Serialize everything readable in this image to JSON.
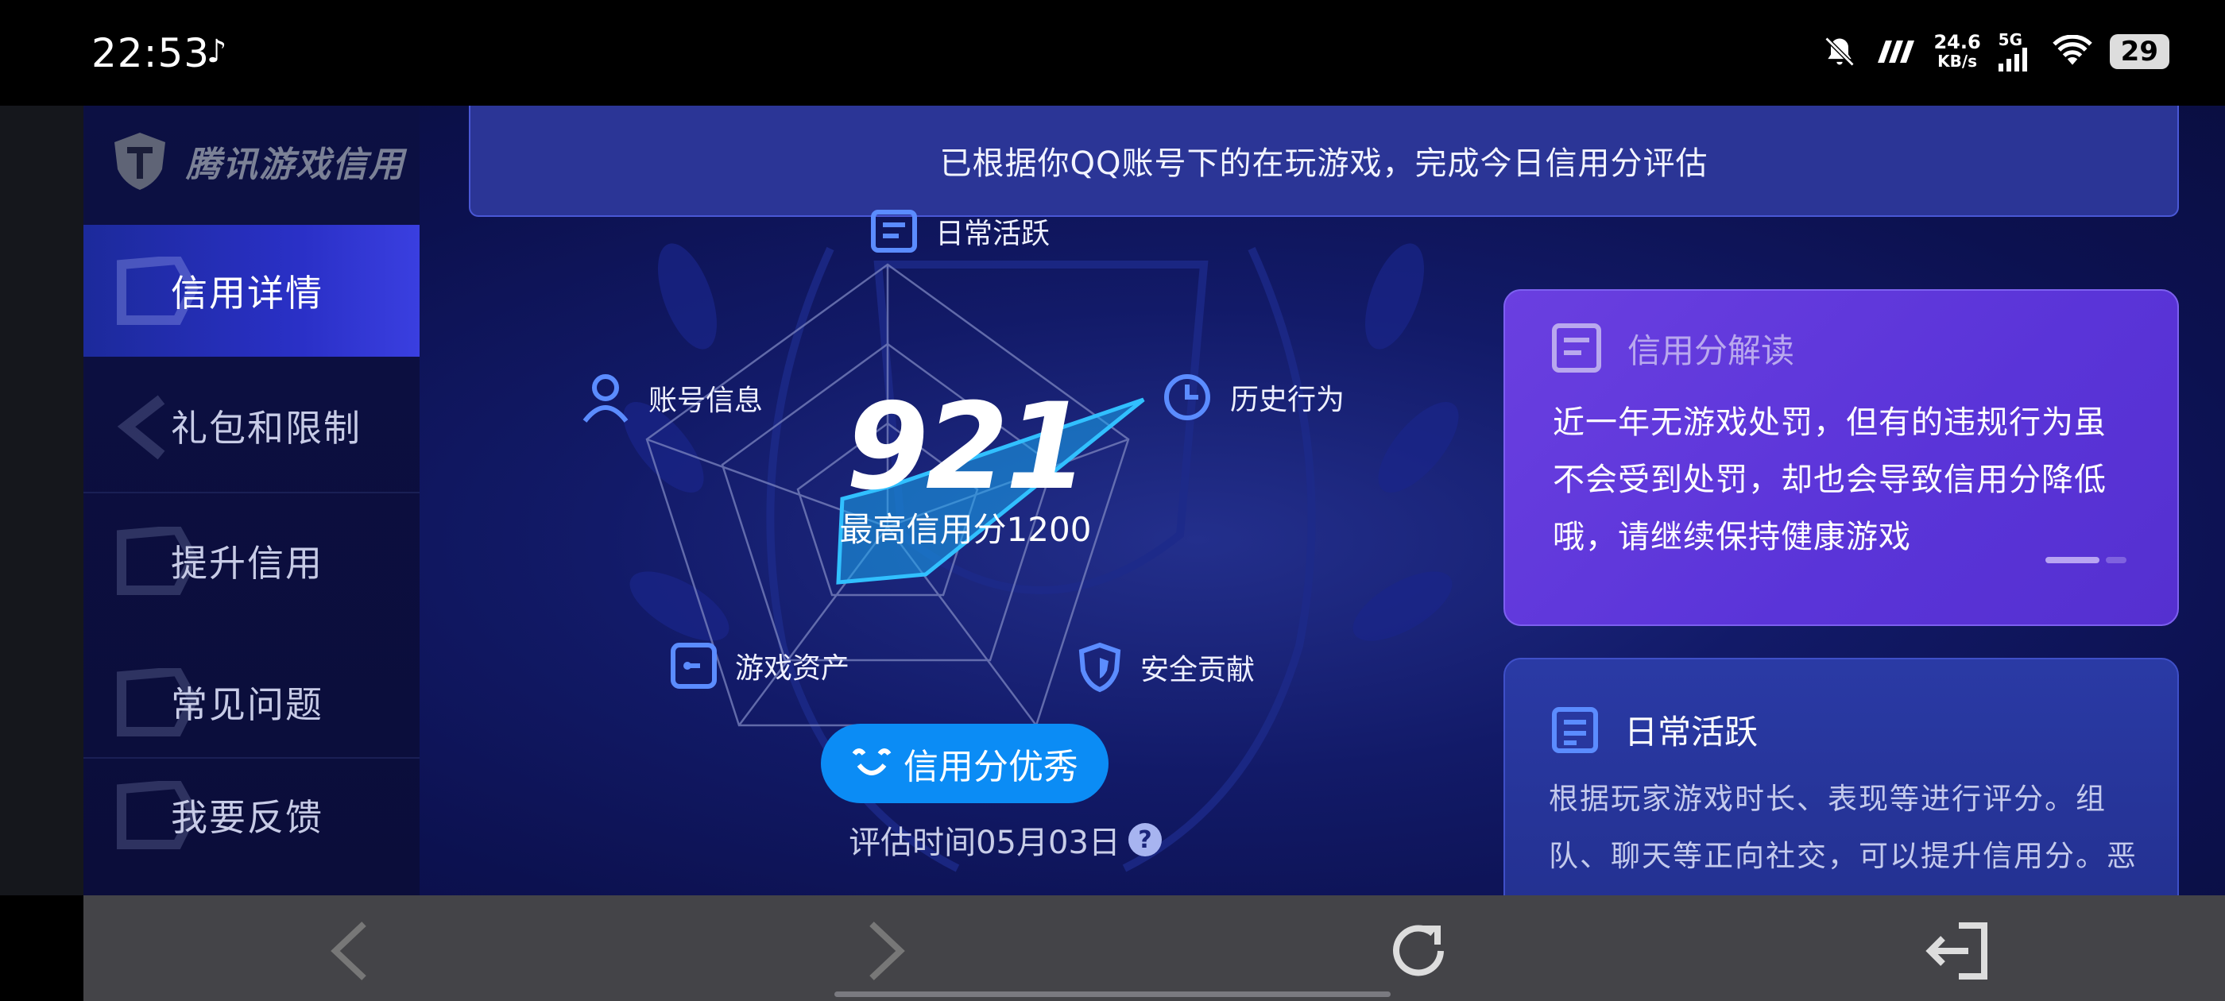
{
  "status_bar": {
    "time": "22:53",
    "tiktok_glyph": "♪",
    "net_speed_top": "24.6",
    "net_speed_unit": "KB/s",
    "network": "5G",
    "battery": "29"
  },
  "sidebar": {
    "logo_text": "腾讯游戏信用",
    "items": [
      {
        "label": "信用详情",
        "active": true
      },
      {
        "label": "礼包和限制",
        "active": false
      },
      {
        "label": "提升信用",
        "active": false
      },
      {
        "label": "常见问题",
        "active": false
      },
      {
        "label": "我要反馈",
        "active": false
      }
    ]
  },
  "banner": {
    "text": "已根据你QQ账号下的在玩游戏，完成今日信用分评估"
  },
  "radar": {
    "dimensions": {
      "daily": "日常活跃",
      "account": "账号信息",
      "history": "历史行为",
      "assets": "游戏资产",
      "security": "安全贡献"
    },
    "score": "921",
    "max_score_text": "最高信用分1200",
    "status_pill": "信用分优秀",
    "eval_time": "评估时间05月03日",
    "help_glyph": "?"
  },
  "card_interpret": {
    "title": "信用分解读",
    "body": "近一年无游戏处罚，但有的违规行为虽不会受到处罚，却也会导致信用分降低哦，请继续保持健康游戏"
  },
  "card_daily": {
    "title": "日常活跃",
    "body": "根据玩家游戏时长、表现等进行评分。组队、聊天等正向社交，可以提升信用分。恶"
  },
  "colors": {
    "accent_blue": "#0b8cf5",
    "card_purple": "#6a3fe0",
    "radar_fill": "#1aa8f0"
  },
  "bottom_nav": {
    "icons": [
      "back-icon",
      "forward-icon",
      "refresh-icon",
      "exit-icon"
    ]
  }
}
